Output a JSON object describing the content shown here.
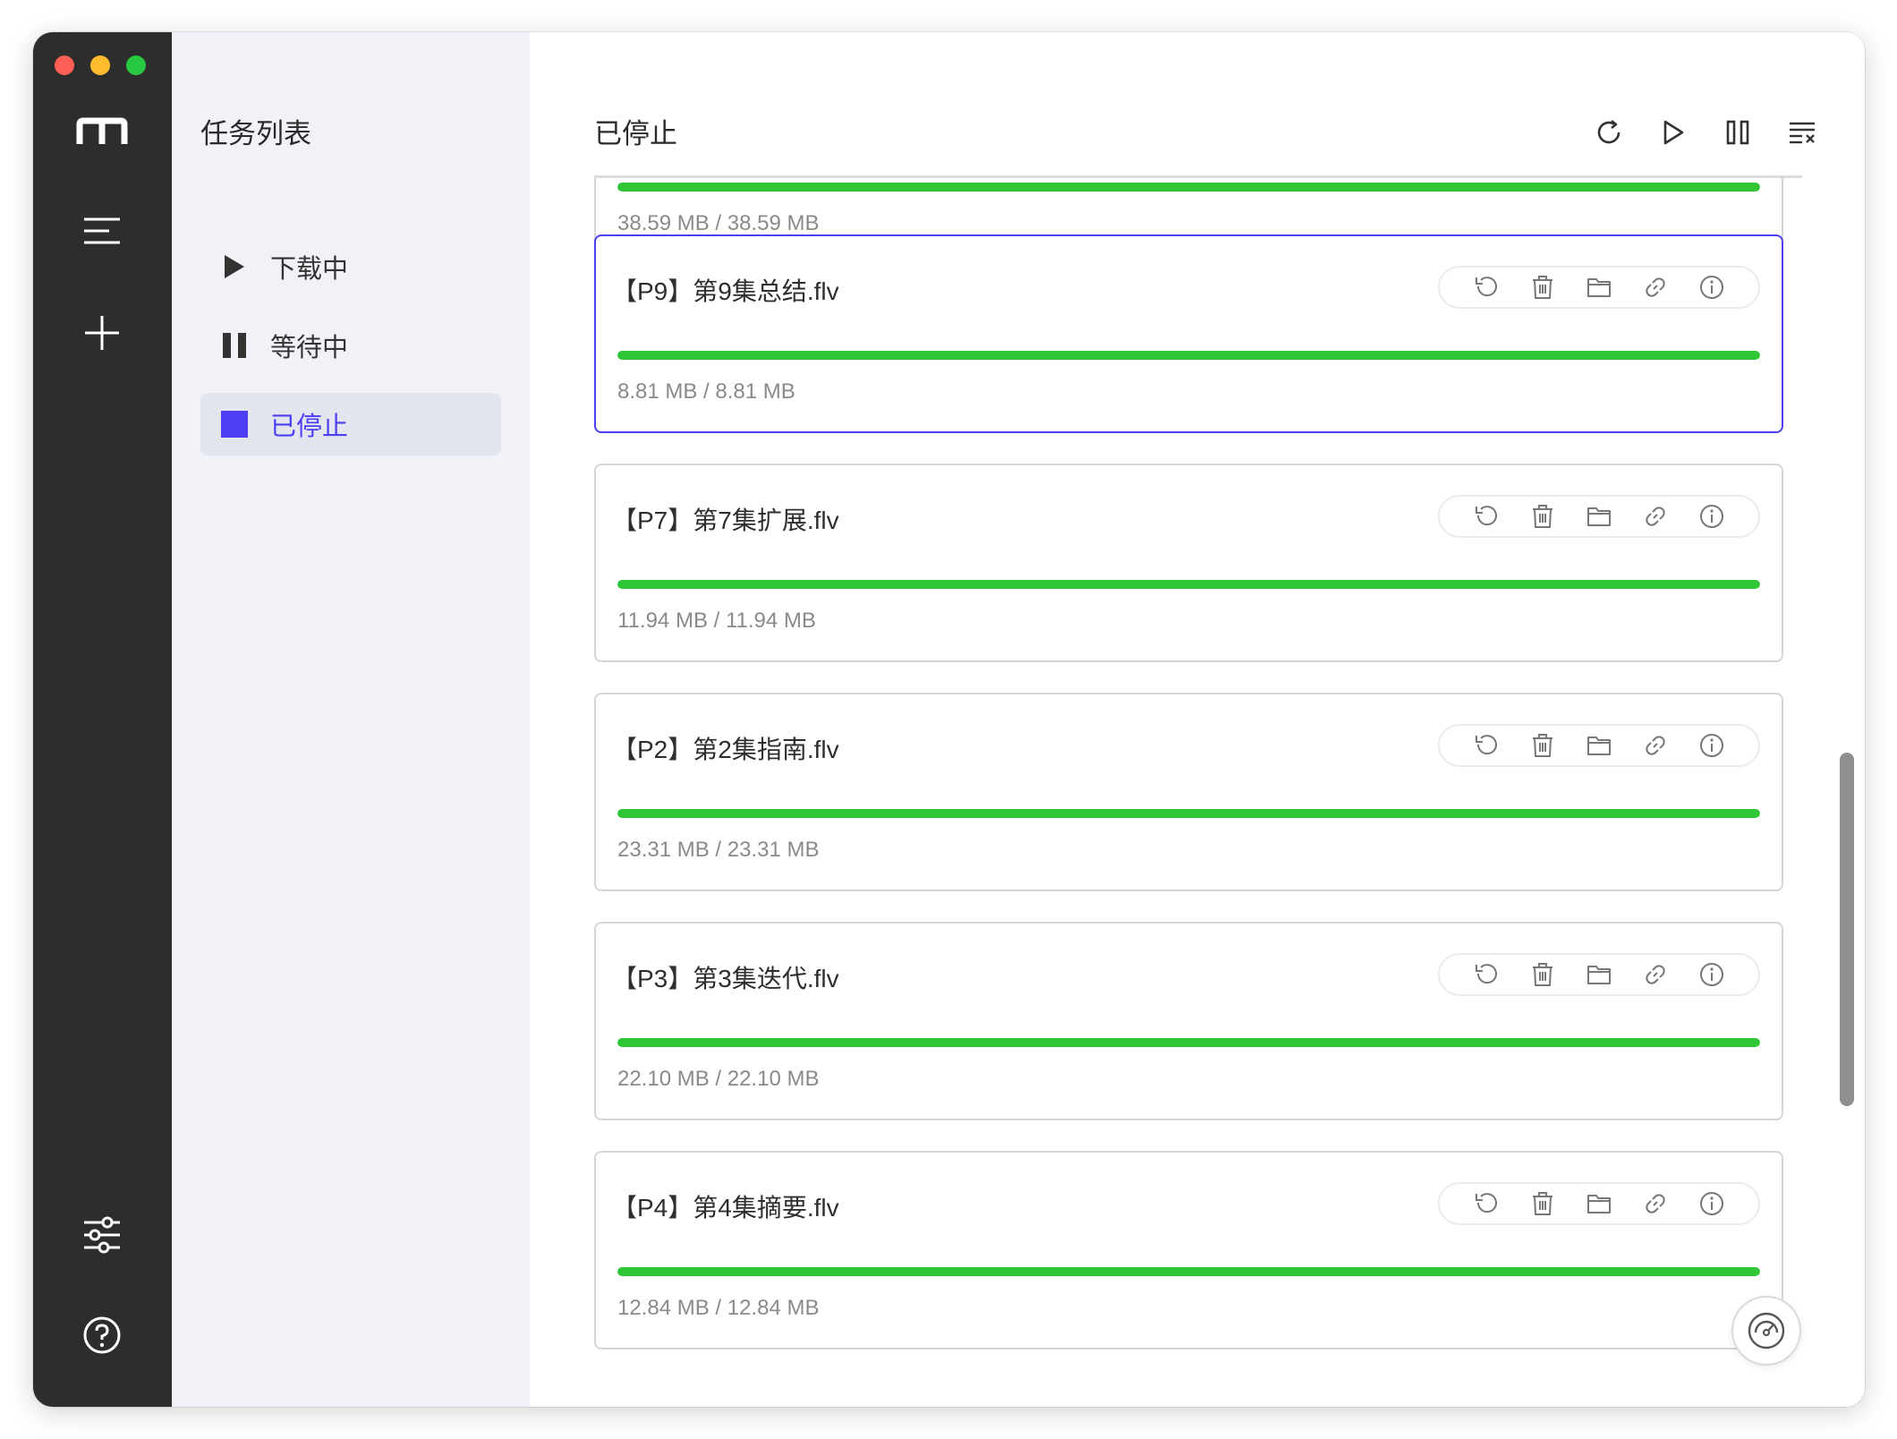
{
  "nav": {
    "icons": [
      "motrix-logo-icon",
      "menu-lines-icon",
      "plus-icon",
      "sliders-icon",
      "help-circle-icon"
    ]
  },
  "sidebar": {
    "title": "任务列表",
    "items": [
      {
        "label": "下载中",
        "icon": "play-icon",
        "active": false
      },
      {
        "label": "等待中",
        "icon": "pause-icon",
        "active": false
      },
      {
        "label": "已停止",
        "icon": "stop-square-icon",
        "active": true
      }
    ]
  },
  "main": {
    "title": "已停止",
    "toolbar": [
      "refresh-icon",
      "play-outline-icon",
      "pause-outline-icon",
      "clear-list-icon"
    ]
  },
  "tasks": [
    {
      "name": "",
      "size": "38.59 MB / 38.59 MB",
      "progress": 1.0,
      "selected": false
    },
    {
      "name": "【P9】第9集总结.flv",
      "size": "8.81 MB / 8.81 MB",
      "progress": 1.0,
      "selected": true
    },
    {
      "name": "【P7】第7集扩展.flv",
      "size": "11.94 MB / 11.94 MB",
      "progress": 1.0,
      "selected": false
    },
    {
      "name": "【P2】第2集指南.flv",
      "size": "23.31 MB / 23.31 MB",
      "progress": 1.0,
      "selected": false
    },
    {
      "name": "【P3】第3集迭代.flv",
      "size": "22.10 MB / 22.10 MB",
      "progress": 1.0,
      "selected": false
    },
    {
      "name": "【P4】第4集摘要.flv",
      "size": "12.84 MB / 12.84 MB",
      "progress": 1.0,
      "selected": false
    }
  ],
  "task_actions": [
    "restart-icon",
    "trash-icon",
    "folder-icon",
    "link-icon",
    "info-icon"
  ],
  "colors": {
    "accent": "#4b3ef3",
    "progress": "#2fc535",
    "nav_bg": "#2d2d2d",
    "sidebar_bg": "#f0f2f7"
  }
}
